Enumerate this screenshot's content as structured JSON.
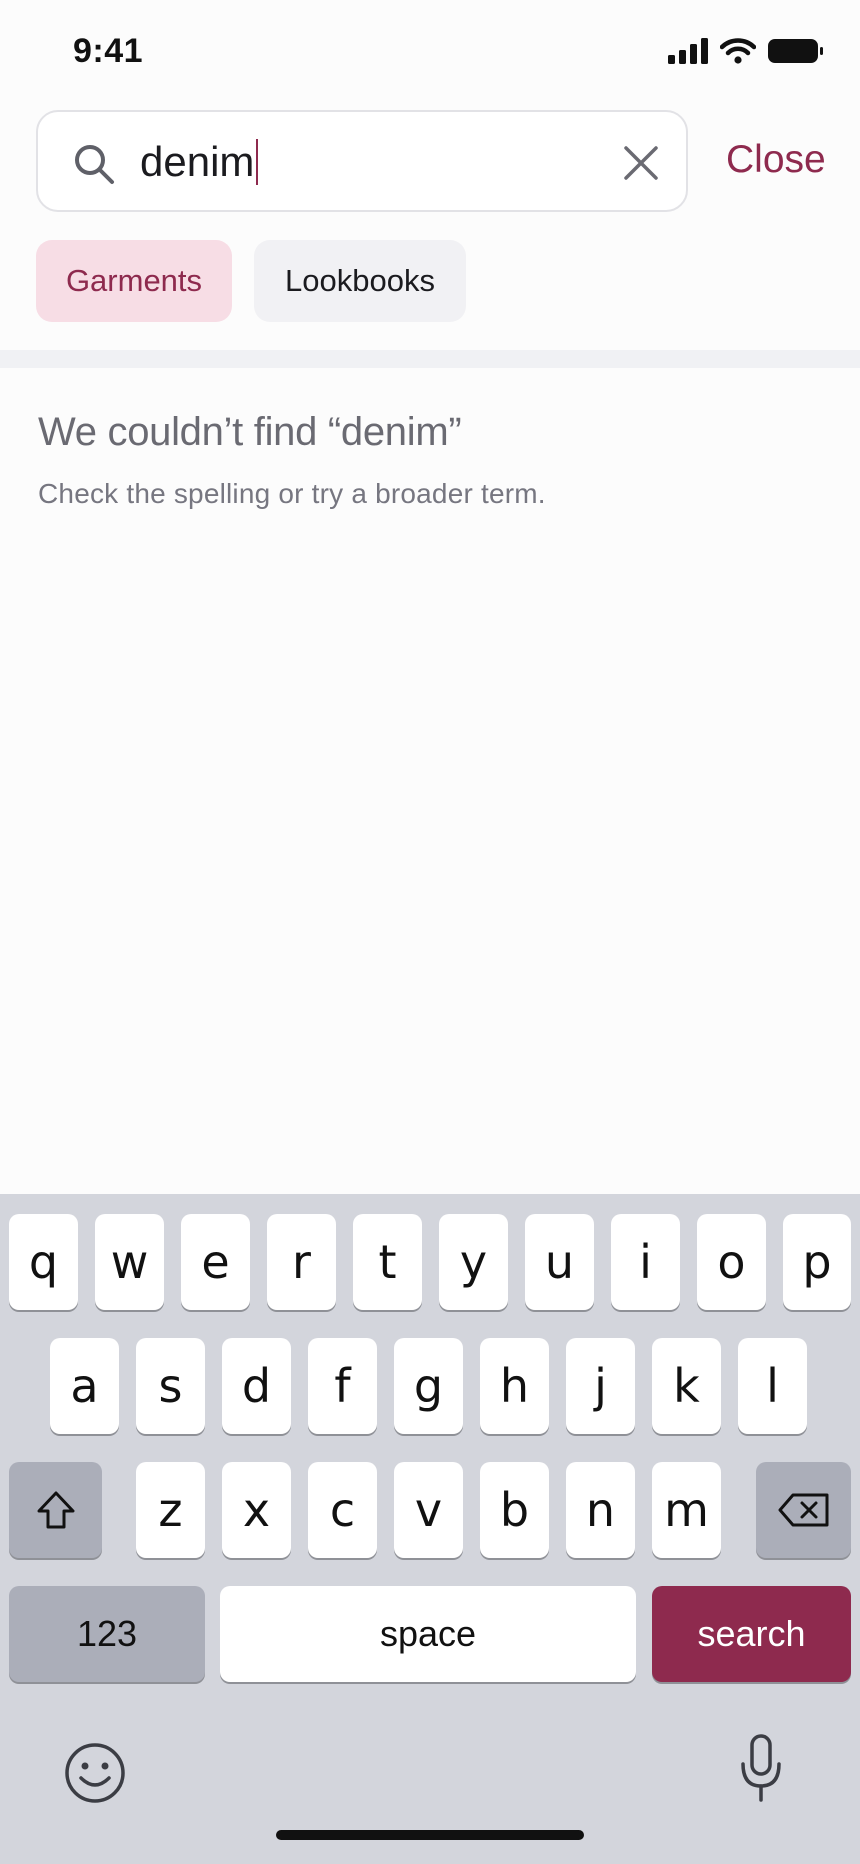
{
  "status": {
    "time": "9:41",
    "icons": [
      "cellular-signal-icon",
      "wifi-icon",
      "battery-icon"
    ]
  },
  "search": {
    "query": "denim",
    "clear_icon": "close-icon",
    "close_label": "Close"
  },
  "filters": {
    "chips": [
      {
        "label": "Garments",
        "selected": true
      },
      {
        "label": "Lookbooks",
        "selected": false
      }
    ]
  },
  "empty_state": {
    "title": "We couldn’t find “denim”",
    "subtitle": "Check the spelling or try a broader term."
  },
  "keyboard": {
    "row1": [
      "q",
      "w",
      "e",
      "r",
      "t",
      "y",
      "u",
      "i",
      "o",
      "p"
    ],
    "row2": [
      "a",
      "s",
      "d",
      "f",
      "g",
      "h",
      "j",
      "k",
      "l"
    ],
    "row3": [
      "z",
      "x",
      "c",
      "v",
      "b",
      "n",
      "m"
    ],
    "numbers_label": "123",
    "space_label": "space",
    "search_label": "search",
    "icons": [
      "shift-icon",
      "backspace-icon",
      "emoji-icon",
      "microphone-icon"
    ]
  },
  "colors": {
    "accent": "#8e2a4e",
    "chip_selected_bg": "#f7dde5",
    "keyboard_bg": "#d3d5dc"
  }
}
